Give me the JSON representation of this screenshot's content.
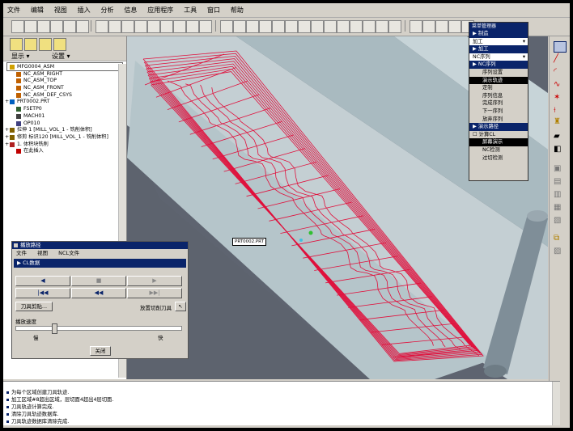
{
  "menubar": [
    "文件",
    "编辑",
    "视图",
    "插入",
    "分析",
    "信息",
    "应用程序",
    "工具",
    "窗口",
    "帮助"
  ],
  "left_panel": {
    "tabs": {
      "show": "显示 ▾",
      "settings": "设置 ▾"
    },
    "tree": [
      {
        "label": "MFG0004_ASM",
        "icon": "assembly-icon",
        "indent": 0
      },
      {
        "label": "NC_ASM_RIGHT",
        "icon": "datum-plane-icon",
        "indent": 1
      },
      {
        "label": "NC_ASM_TOP",
        "icon": "datum-plane-icon",
        "indent": 1
      },
      {
        "label": "NC_ASM_FRONT",
        "icon": "datum-plane-icon",
        "indent": 1
      },
      {
        "label": "NC_ASM_DEF_CSYS",
        "icon": "csys-icon",
        "indent": 1
      },
      {
        "label": "PRT0002.PRT",
        "icon": "part-icon",
        "indent": 0,
        "expand": "+"
      },
      {
        "label": "FSETP0",
        "icon": "feature-icon",
        "indent": 1
      },
      {
        "label": "MACH01",
        "icon": "machine-icon",
        "indent": 1
      },
      {
        "label": "OP010",
        "icon": "operation-icon",
        "indent": 1
      },
      {
        "label": "拉伸 1 [MILL_VOL_1 - 铣削体积]",
        "icon": "extrude-icon",
        "indent": 0,
        "expand": "+"
      },
      {
        "label": "修剪 标识120 [MILL_VOL_1 - 铣削体积]",
        "icon": "trim-icon",
        "indent": 0,
        "expand": "+"
      },
      {
        "label": "1. 体积块铣削",
        "icon": "volume-mill-icon",
        "indent": 0,
        "expand": "+"
      },
      {
        "label": "在此插入",
        "icon": "insert-here-icon",
        "indent": 1
      }
    ]
  },
  "viewport": {
    "part_label": "PRT0002.PRT",
    "colors": {
      "background": "#5e6470",
      "part": "#b6c8cc",
      "toolpath": "#e0103c",
      "tool": "#7f8e98"
    }
  },
  "menu_manager": {
    "title": "菜单管理器",
    "rows": [
      {
        "text": "制造",
        "kind": "head"
      },
      {
        "text": "加工",
        "kind": "dropdown"
      },
      {
        "text": "加工",
        "kind": "head"
      },
      {
        "text": "NC序列",
        "kind": "dropdown"
      },
      {
        "text": "NC序列",
        "kind": "head"
      },
      {
        "text": "序列设置",
        "kind": "sub"
      },
      {
        "text": "演示轨迹",
        "kind": "selected"
      },
      {
        "text": "定制",
        "kind": "sub"
      },
      {
        "text": "序列信息",
        "kind": "sub"
      },
      {
        "text": "完成序列",
        "kind": "sub"
      },
      {
        "text": "下一序列",
        "kind": "sub"
      },
      {
        "text": "放弃序列",
        "kind": "sub"
      },
      {
        "text": "演示路径",
        "kind": "head"
      },
      {
        "text": "计算CL",
        "kind": "check"
      },
      {
        "text": "屏幕演示",
        "kind": "selected"
      },
      {
        "text": "NC检测",
        "kind": "sub"
      },
      {
        "text": "过切检测",
        "kind": "sub"
      }
    ]
  },
  "playback": {
    "title": "播放路径",
    "menu": [
      "文件",
      "视图",
      "NCL文件"
    ],
    "cl_label": "CL数据",
    "tool_clip_button": "刀具剪贴...",
    "place_tool": "放置切削刀具",
    "speed_label": "播放速度",
    "speed_value": 0.22,
    "slow": "慢",
    "fast": "快",
    "close": "关闭"
  },
  "messages": [
    "为每个区域创建刀具轨迹.",
    "加工区域#8超出区域，层切面4超出4层切面.",
    "刀具轨迹计算完成.",
    "清除刀具轨迹数据库.",
    "刀具轨迹数据库清除完成."
  ]
}
